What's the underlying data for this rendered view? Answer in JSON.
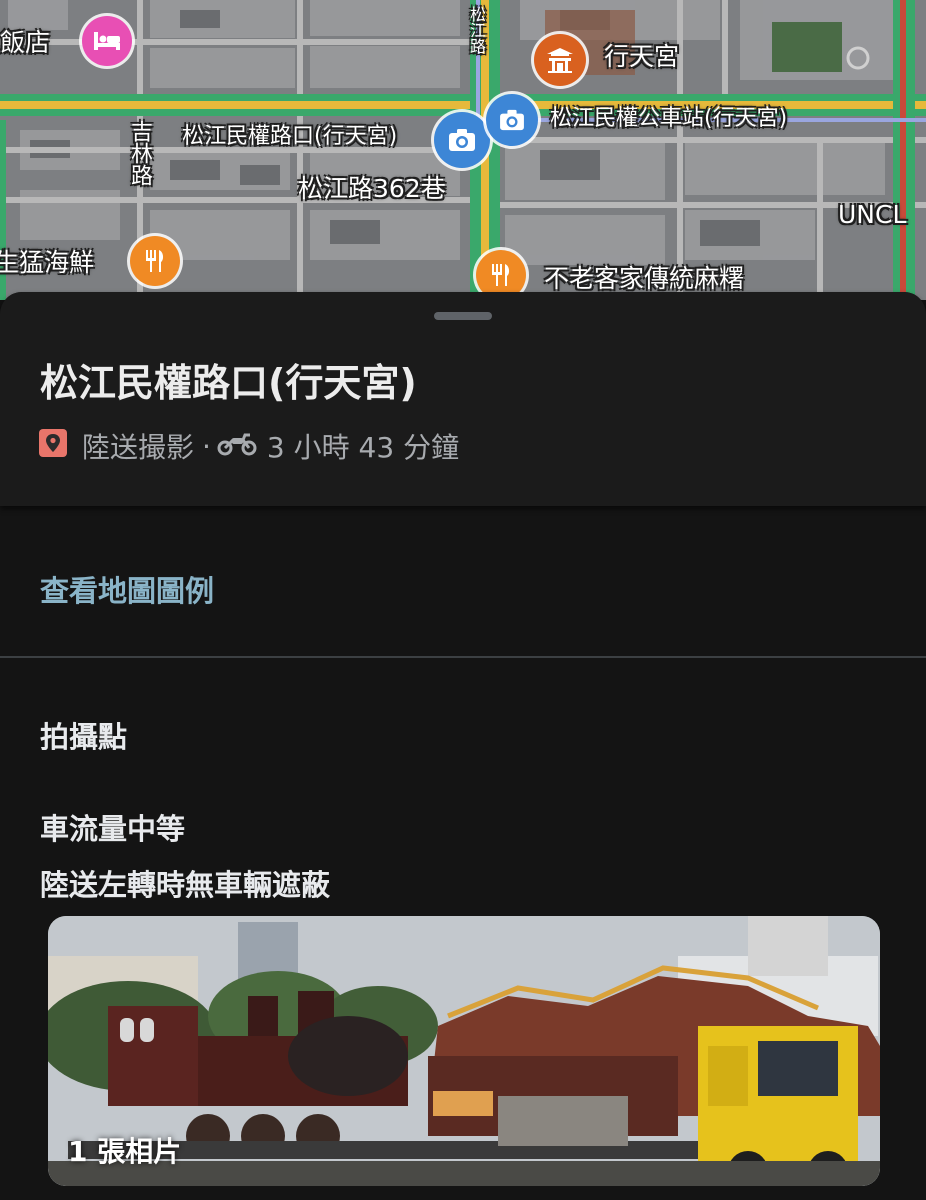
{
  "map": {
    "labels": {
      "hotel": "飯店",
      "temple": "行天宮",
      "intersection": "松江民權路口(行天宮)",
      "bus_stop": "松江民權公車站(行天宮)",
      "lane": "松江路362巷",
      "street_jilin": "吉林路",
      "seafood": "生猛海鮮",
      "hakka": "不老客家傳統麻糬",
      "uniqlo": "UNCL",
      "street_vertical_partial": "松江路"
    },
    "pins": {
      "hotel_icon": "bed-icon",
      "temple_icon": "temple-icon",
      "photo_icon": "camera-icon",
      "restaurant_icon": "fork-knife-icon"
    },
    "colors": {
      "hotel_pin": "#e84fb4",
      "temple_pin": "#d9611f",
      "photo_pin": "#3d86d6",
      "restaurant_pin": "#f08a24"
    }
  },
  "place": {
    "title": "松江民權路口(行天宮)",
    "category": "陸送撮影",
    "separator": "·",
    "travel_time": "3 小時 43 分鐘",
    "location_icon": "location-pin-icon",
    "travel_mode_icon": "motorcycle-icon",
    "location_icon_color": "#e8756a"
  },
  "legend_link": "查看地圖圖例",
  "details": {
    "section_title": "拍攝點",
    "lines": [
      "車流量中等",
      "陸送左轉時無車輛遮蔽"
    ]
  },
  "photo": {
    "count_label": "1 張相片"
  },
  "colors": {
    "link": "#8ab4c8",
    "sheet_bg": "#141414",
    "header_bg": "#1b1b1b"
  }
}
